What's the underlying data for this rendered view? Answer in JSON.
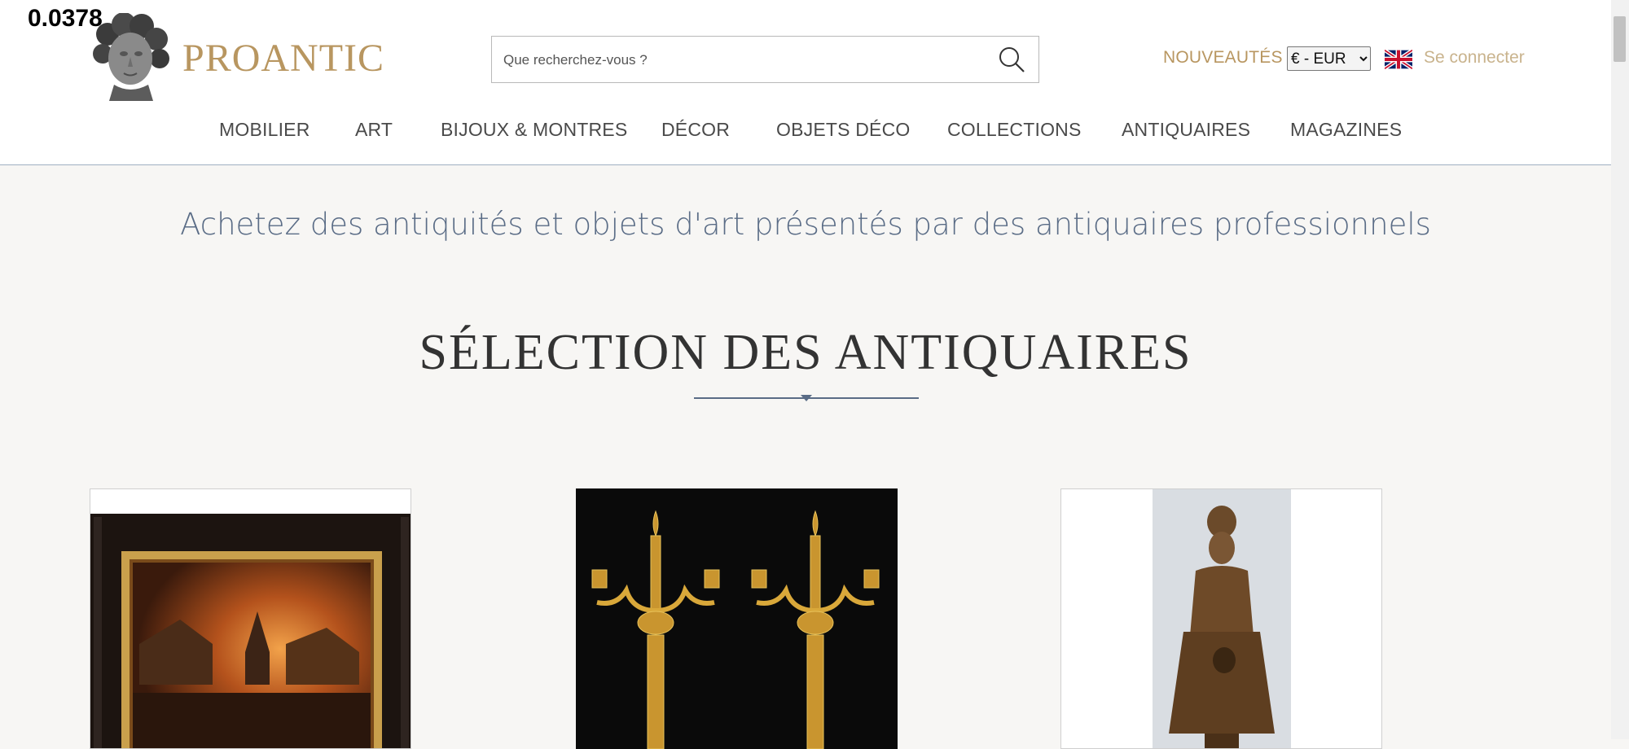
{
  "overlay": {
    "value": "0.0378"
  },
  "header": {
    "brand": "PROANTIC",
    "search": {
      "placeholder": "Que recherchez-vous ?"
    },
    "new_label": "NOUVEAUTÉS",
    "currency": {
      "selected": "€ - EUR"
    },
    "language_flag": "uk-flag-icon",
    "login_label": "Se connecter"
  },
  "nav": {
    "items": [
      "MOBILIER",
      "ART",
      "BIJOUX & MONTRES",
      "DÉCOR",
      "OBJETS DÉCO",
      "COLLECTIONS",
      "ANTIQUAIRES",
      "MAGAZINES"
    ]
  },
  "main": {
    "tagline": "Achetez des antiquités et objets d'art présentés par des antiquaires professionnels",
    "section_title": "SÉLECTION DES ANTIQUAIRES",
    "cards": [
      {
        "image": "painting-fire-scene"
      },
      {
        "image": "gilt-bronze-candelabra-pair"
      },
      {
        "image": "bronze-girl-statue"
      }
    ]
  },
  "colors": {
    "brand_gold": "#b89660",
    "login_gold": "#c9b38d",
    "accent_blue": "#5a6c86",
    "page_bg": "#f7f6f4"
  }
}
